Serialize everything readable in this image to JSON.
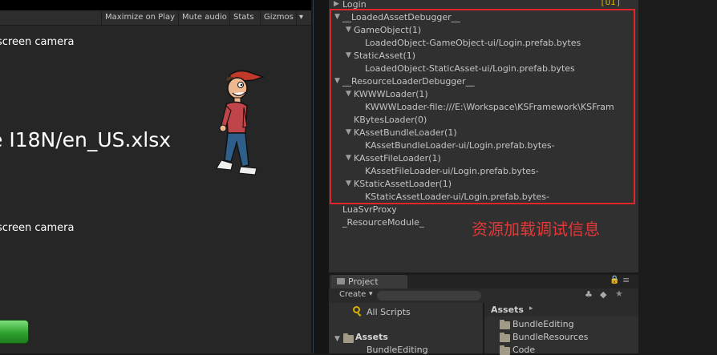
{
  "game_toolbar": {
    "maximize": "Maximize on Play",
    "mute": "Mute audio",
    "stats": "Stats",
    "gizmos": "Gizmos",
    "gizmos_arrow": "▾"
  },
  "game_view": {
    "text1": "screen camera",
    "text2": "e I18N/en_US.xlsx",
    "text3": "screen camera"
  },
  "hierarchy": {
    "top_item": "Login",
    "ui_tag": "[UI]",
    "items": [
      "__LoadedAssetDebugger__",
      "GameObject(1)",
      "LoadedObject-GameObject-ui/Login.prefab.bytes",
      "StaticAsset(1)",
      "LoadedObject-StaticAsset-ui/Login.prefab.bytes",
      "__ResourceLoaderDebugger__",
      "KWWWLoader(1)",
      "KWWWLoader-file:///E:\\Workspace\\KSFramework\\KSFram",
      "KBytesLoader(0)",
      "KAssetBundleLoader(1)",
      "KAssetBundleLoader-ui/Login.prefab.bytes-",
      "KAssetFileLoader(1)",
      "KAssetFileLoader-ui/Login.prefab.bytes-",
      "KStaticAssetLoader(1)",
      "KStaticAssetLoader-ui/Login.prefab.bytes-",
      "LuaSvrProxy",
      "_ResourceModule_"
    ],
    "annotation": "资源加载调试信息"
  },
  "project": {
    "tab": "Project",
    "create": "Create",
    "create_arrow": "▾",
    "left_items": [
      "All Scripts",
      "Assets",
      "BundleEditing"
    ],
    "breadcrumb": "Assets",
    "breadcrumb_arrow": "▸",
    "right_items": [
      "BundleEditing",
      "BundleResources",
      "Code"
    ]
  },
  "colors": {
    "highlight_box": "#e0262b",
    "annotation": "#e23838",
    "ui_tag": "#d7b200"
  }
}
